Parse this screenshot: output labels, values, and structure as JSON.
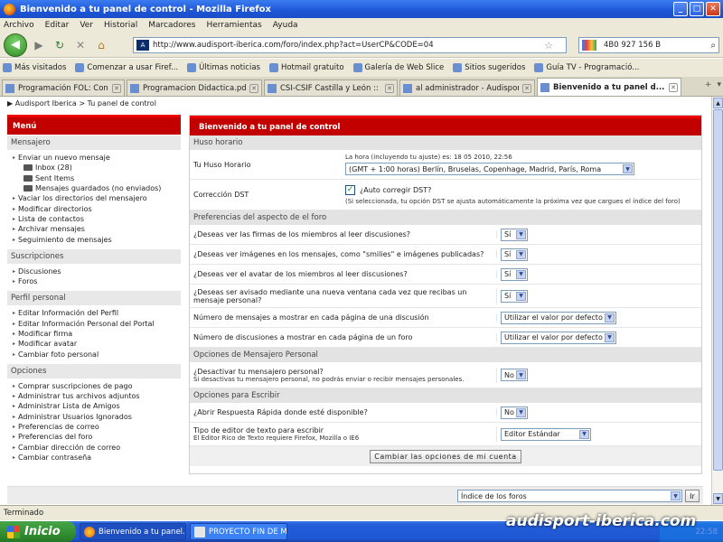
{
  "window": {
    "title": "Bienvenido a tu panel de control - Mozilla Firefox"
  },
  "menubar": [
    "Archivo",
    "Editar",
    "Ver",
    "Historial",
    "Marcadores",
    "Herramientas",
    "Ayuda"
  ],
  "nav": {
    "url": "http://www.audisport-iberica.com/foro/index.php?act=UserCP&CODE=04",
    "search_value": "4B0 927 156 B"
  },
  "bookmarks": [
    "Más visitados",
    "Comenzar a usar Firef...",
    "Últimas noticias",
    "Hotmail gratuito",
    "Galería de Web Slice",
    "Sitios sugeridos",
    "Guía TV - Programació..."
  ],
  "tabs": [
    {
      "label": "Programación FOL: Conteni...",
      "active": false
    },
    {
      "label": "Programacion Didactica.pdf...",
      "active": false
    },
    {
      "label": "CSI-CSIF Castilla y León :: ...",
      "active": false
    },
    {
      "label": "al administrador - Audisport ...",
      "active": false
    },
    {
      "label": "Bienvenido a tu panel d...",
      "active": true
    }
  ],
  "breadcrumb": {
    "arrow": "▶",
    "text": "Audisport Iberica > Tu panel de control"
  },
  "sidebar": {
    "title": "Menú",
    "sections": [
      {
        "title": "Mensajero",
        "items": [
          {
            "label": "Enviar un nuevo mensaje",
            "sub": false,
            "folder": false
          },
          {
            "label": "Inbox (28)",
            "sub": true,
            "folder": true
          },
          {
            "label": "Sent Items",
            "sub": true,
            "folder": true
          },
          {
            "label": "Mensajes guardados (no enviados)",
            "sub": true,
            "folder": true
          },
          {
            "label": "Vaciar los directorios del mensajero",
            "sub": false,
            "folder": false
          },
          {
            "label": "Modificar directorios",
            "sub": false,
            "folder": false
          },
          {
            "label": "Lista de contactos",
            "sub": false,
            "folder": false
          },
          {
            "label": "Archivar mensajes",
            "sub": false,
            "folder": false
          },
          {
            "label": "Seguimiento de mensajes",
            "sub": false,
            "folder": false
          }
        ]
      },
      {
        "title": "Suscripciones",
        "items": [
          {
            "label": "Discusiones",
            "sub": false,
            "folder": false
          },
          {
            "label": "Foros",
            "sub": false,
            "folder": false
          }
        ]
      },
      {
        "title": "Perfil personal",
        "items": [
          {
            "label": "Editar Información del Perfil",
            "sub": false,
            "folder": false
          },
          {
            "label": "Editar Información Personal del Portal",
            "sub": false,
            "folder": false
          },
          {
            "label": "Modificar firma",
            "sub": false,
            "folder": false
          },
          {
            "label": "Modificar avatar",
            "sub": false,
            "folder": false
          },
          {
            "label": "Cambiar foto personal",
            "sub": false,
            "folder": false
          }
        ]
      },
      {
        "title": "Opciones",
        "items": [
          {
            "label": "Comprar suscripciones de pago",
            "sub": false,
            "folder": false
          },
          {
            "label": "Administrar tus archivos adjuntos",
            "sub": false,
            "folder": false
          },
          {
            "label": "Administrar Lista de Amigos",
            "sub": false,
            "folder": false
          },
          {
            "label": "Administrar Usuarios Ignorados",
            "sub": false,
            "folder": false
          },
          {
            "label": "Preferencias de correo",
            "sub": false,
            "folder": false
          },
          {
            "label": "Preferencias del foro",
            "sub": false,
            "folder": false
          },
          {
            "label": "Cambiar dirección de correo",
            "sub": false,
            "folder": false
          },
          {
            "label": "Cambiar contraseña",
            "sub": false,
            "folder": false
          }
        ]
      }
    ]
  },
  "main": {
    "title": "Bienvenido a tu panel de control",
    "timezone_section": "Huso horario",
    "timezone_label": "Tu Huso Horario",
    "timezone_note": "La hora (incluyendo tu ajuste) es: 18 05 2010, 22:56",
    "timezone_value": "(GMT + 1:00 horas) Berlín, Bruselas, Copenhage, Madrid, París, Roma",
    "dst_label": "Corrección DST",
    "dst_check_label": "¿Auto corregir DST?",
    "dst_checked": true,
    "dst_note": "(Si seleccionada, tu opción DST se ajusta automáticamente la próxima vez que cargues el índice del foro)",
    "prefs_section": "Preferencias del aspecto de el foro",
    "prefs": [
      {
        "q": "¿Deseas ver las firmas de los miembros al leer discusiones?",
        "a": "Sí"
      },
      {
        "q": "¿Deseas ver imágenes en los mensajes, como \"smilies\" e imágenes publicadas?",
        "a": "Sí"
      },
      {
        "q": "¿Deseas ver el avatar de los miembros al leer discusiones?",
        "a": "Sí"
      },
      {
        "q": "¿Deseas ser avisado mediante una nueva ventana cada vez que recibas un mensaje personal?",
        "a": "Sí"
      },
      {
        "q": "Número de mensajes a mostrar en cada página de una discusión",
        "a": "Utilizar el valor por defecto"
      },
      {
        "q": "Número de discusiones a mostrar en cada página de un foro",
        "a": "Utilizar el valor por defecto"
      }
    ],
    "pm_section": "Opciones de Mensajero Personal",
    "pm_q": "¿Desactivar tu mensajero personal?",
    "pm_note": "Si desactivas tu mensajero personal, no podrás enviar o recibir mensajes personales.",
    "pm_a": "No",
    "write_section": "Opciones para Escribir",
    "quick_q": "¿Abrir Respuesta Rápida donde esté disponible?",
    "quick_a": "No",
    "editor_q": "Tipo de editor de texto para escribir",
    "editor_note": "El Editor Rico de Texto requiere Firefox, Mozilla o IE6",
    "editor_a": "Editor Estándar",
    "submit": "Cambiar las opciones de mi cuenta"
  },
  "jump": {
    "value": "Índice de los foros",
    "button": "Ir"
  },
  "status": "Terminado",
  "taskbar": {
    "start": "Inicio",
    "tasks": [
      "Bienvenido a tu panel...",
      "PROYECTO FIN DE M..."
    ],
    "clock": "22:58",
    "watermark": "audisport-iberica.com"
  }
}
